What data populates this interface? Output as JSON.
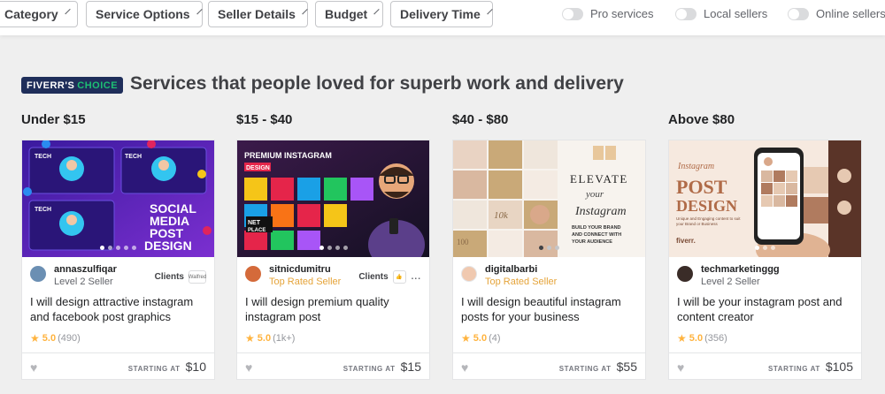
{
  "filters": {
    "dropdowns": [
      "Category",
      "Service Options",
      "Seller Details",
      "Budget",
      "Delivery Time"
    ],
    "toggles": [
      "Pro services",
      "Local sellers",
      "Online sellers"
    ]
  },
  "section": {
    "badge_main": "FIVERR'S",
    "badge_accent": "CHOICE",
    "headline": "Services that people loved for superb work and delivery"
  },
  "columns": [
    {
      "range": "Under $15",
      "thumb_text": [
        "TECH",
        "SOCIAL",
        "MEDIA",
        "POST",
        "DESIGN"
      ],
      "seller": "annaszulfiqar",
      "level": "Level 2 Seller",
      "clients_label": "Clients",
      "client_logo": "Walfred",
      "title": "I will design attractive instagram and facebook post graphics",
      "rating": "5.0",
      "reviews": "(490)",
      "starting_label": "STARTING AT",
      "price": "$10"
    },
    {
      "range": "$15 - $40",
      "thumb_text": [
        "PREMIUM INSTAGRAM",
        "DESIGN",
        "NET",
        "PLACE"
      ],
      "seller": "sitnicdumitru",
      "level": "Top Rated Seller",
      "clients_label": "Clients",
      "more": "...",
      "title": "I will design premium quality instagram post",
      "rating": "5.0",
      "reviews": "(1k+)",
      "starting_label": "STARTING AT",
      "price": "$15"
    },
    {
      "range": "$40 - $80",
      "thumb_text": [
        "ELEVATE",
        "your",
        "Instagram",
        "BUILD YOUR BRAND",
        "AND CONNECT WITH",
        "YOUR AUDIENCE",
        "10k",
        "100"
      ],
      "seller": "digitalbarbi",
      "level": "Top Rated Seller",
      "title": "I will design beautiful instagram posts for your business",
      "rating": "5.0",
      "reviews": "(4)",
      "starting_label": "STARTING AT",
      "price": "$55"
    },
    {
      "range": "Above $80",
      "thumb_text": [
        "Instagram",
        "POST",
        "DESIGN",
        "Unique and Engaging content to suit",
        "your Brand or Business",
        "fiverr."
      ],
      "seller": "techmarketinggg",
      "level": "Level 2 Seller",
      "title": "I will be your instagram post and content creator",
      "rating": "5.0",
      "reviews": "(356)",
      "starting_label": "STARTING AT",
      "price": "$105"
    }
  ],
  "colors": {
    "badge_bg": "#1f2e5a",
    "badge_accent": "#1dbf73",
    "star": "#ffb33e",
    "top_rated": "#e5a43a"
  },
  "icons": [
    "chevron-down-icon",
    "toggle-switch",
    "star-icon",
    "heart-icon",
    "more-icon"
  ]
}
